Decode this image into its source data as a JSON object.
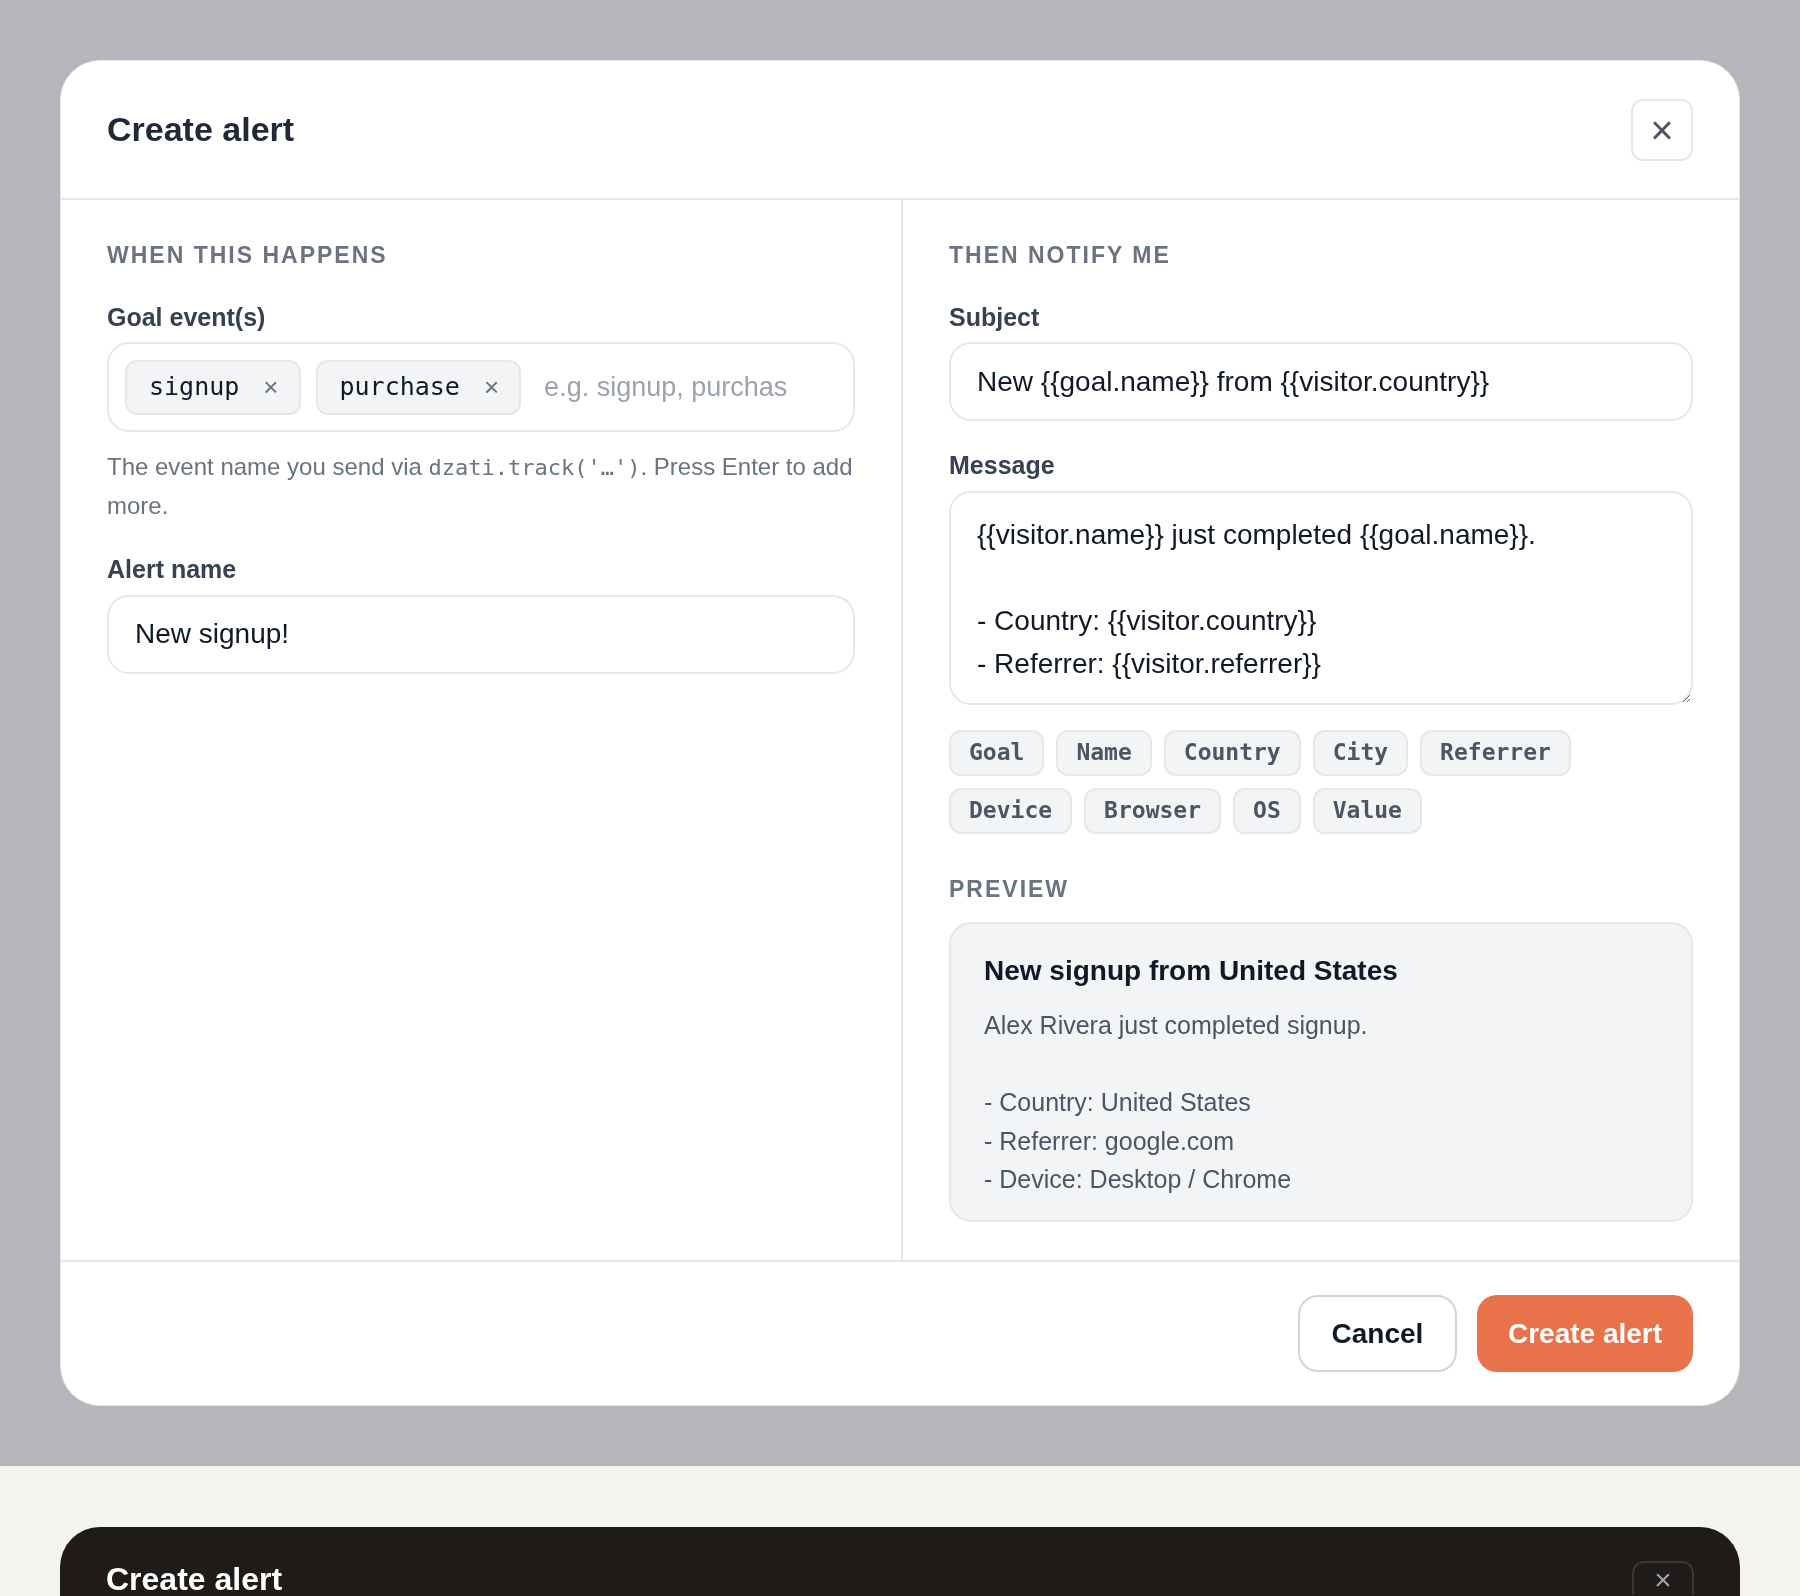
{
  "dialog": {
    "title": "Create alert",
    "close": "×"
  },
  "trigger": {
    "section": "WHEN THIS HAPPENS",
    "goal_label": "Goal event(s)",
    "goal_events": [
      {
        "label": "signup",
        "remove": "×"
      },
      {
        "label": "purchase",
        "remove": "×"
      }
    ],
    "goal_placeholder": "e.g. signup, purchas",
    "help": {
      "before": "The event name you send via ",
      "code": "dzati.track('…')",
      "after": ". Press Enter to add more."
    },
    "name_label": "Alert name",
    "name_value": "New signup!"
  },
  "notify": {
    "section": "THEN NOTIFY ME",
    "subject_label": "Subject",
    "subject_value": "New {{goal.name}} from {{visitor.country}}",
    "message_label": "Message",
    "message_value": "{{visitor.name}} just completed {{goal.name}}.\n\n- Country: {{visitor.country}}\n- Referrer: {{visitor.referrer}}",
    "variables": [
      "Goal",
      "Name",
      "Country",
      "City",
      "Referrer",
      "Device",
      "Browser",
      "OS",
      "Value"
    ],
    "preview_label": "PREVIEW",
    "preview": {
      "title": "New signup from United States",
      "intro": "Alex Rivera just completed signup.",
      "details": [
        "- Country: United States",
        "- Referrer: google.com",
        "- Device: Desktop / Chrome"
      ]
    }
  },
  "buttons": {
    "cancel": "Cancel",
    "create": "Create alert"
  },
  "dark_dialog": {
    "title": "Create alert",
    "close": "×"
  }
}
